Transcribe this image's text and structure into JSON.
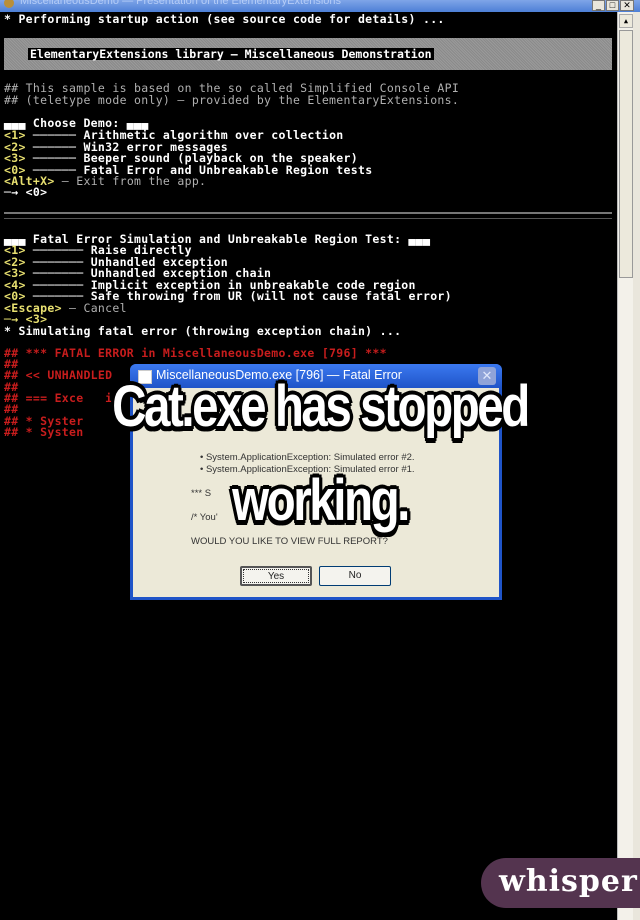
{
  "window": {
    "title": "MiscellaneousDemo — Presentation of the ElementaryExtensions",
    "buttons": {
      "minimize": "_",
      "maximize": "□",
      "close": "✕"
    }
  },
  "console": {
    "startup": "* Performing startup action (see source code for details) ...",
    "banner": "ElementaryExtensions library — Miscellaneous Demonstration",
    "info": [
      "## This sample is based on the so called Simplified Console API",
      "## (teletype mode only) — provided by the ElementaryExtensions."
    ],
    "menu1": {
      "heading": "▄▄▄ Choose Demo: ▄▄▄",
      "items": [
        {
          "key": "<1>",
          "sep": " ────── ",
          "label": "Arithmetic algorithm over collection"
        },
        {
          "key": "<2>",
          "sep": " ────── ",
          "label": "Win32 error messages"
        },
        {
          "key": "<3>",
          "sep": " ────── ",
          "label": "Beeper sound (playback on the speaker)"
        },
        {
          "key": "<0>",
          "sep": " ────── ",
          "label": "Fatal Error and Unbreakable Region tests"
        }
      ],
      "exit_key": "<Alt+X>",
      "exit_label": " — Exit from the app.",
      "choice": "─→ <0>"
    },
    "menu2": {
      "heading": "▄▄▄ Fatal Error Simulation and Unbreakable Region Test: ▄▄▄",
      "items": [
        {
          "key": "<1>",
          "sep": " ─────── ",
          "label": "Raise directly"
        },
        {
          "key": "<2>",
          "sep": " ─────── ",
          "label": "Unhandled exception"
        },
        {
          "key": "<3>",
          "sep": " ─────── ",
          "label": "Unhandled exception chain"
        },
        {
          "key": "<4>",
          "sep": " ─────── ",
          "label": "Implicit exception in unbreakable code region"
        },
        {
          "key": "<0>",
          "sep": " ─────── ",
          "label": "Safe throwing from UR (will not cause fatal error)"
        }
      ],
      "escape_key": "<Escape>",
      "escape_label": " — Cancel",
      "choice": "─→ <3>"
    },
    "simulating": "* Simulating fatal error (throwing exception chain) ...",
    "fatal": [
      "## *** FATAL ERROR in MiscellaneousDemo.exe [796] ***",
      "##",
      "## << UNHANDLED",
      "##",
      "## === Exce   io",
      "##",
      "## * Syster",
      "## * Systen"
    ]
  },
  "dialog": {
    "title": "MiscellaneousDemo.exe [796] — Fatal Error",
    "close": "✕",
    "lines": [
      "• System.ApplicationException: Simulated error #2.",
      "• System.ApplicationException: Simulated error #1.",
      "*** S                                         D! ***",
      "/* You'                  te",
      "WOULD YOU LIKE TO VIEW FULL REPORT?"
    ],
    "yes": "Yes",
    "no": "No"
  },
  "caption": {
    "line1": "Cat.exe has stopped",
    "line2": "working."
  },
  "watermark": "whisper"
}
